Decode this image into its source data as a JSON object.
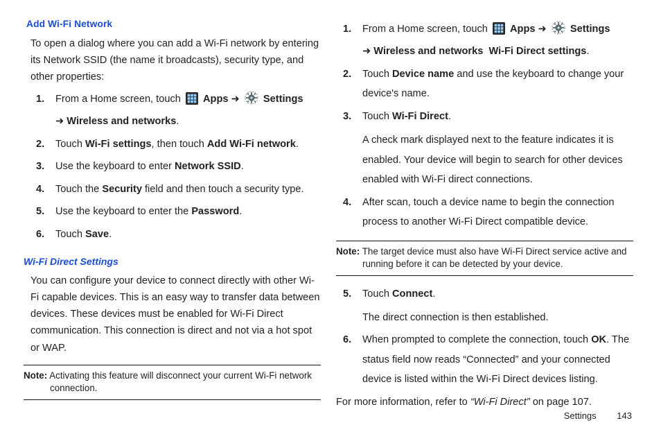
{
  "left": {
    "heading1": "Add Wi-Fi Network",
    "intro": "To open a dialog where you can add a Wi-Fi network by entering its Network SSID (the name it broadcasts), security type, and other properties:",
    "s1_prefix": "From a Home screen, touch ",
    "s1_apps": "Apps",
    "s1_settings": "Settings",
    "s1_line2_label": "Wireless and networks",
    "s2_a": "Touch ",
    "s2_b": "Wi-Fi settings",
    "s2_c": ", then touch ",
    "s2_d": "Add Wi-Fi network",
    "s3_a": "Use the keyboard to enter ",
    "s3_b": "Network SSID",
    "s4_a": "Touch the ",
    "s4_b": "Security",
    "s4_c": " field and then touch a security type.",
    "s5_a": "Use the keyboard to enter the ",
    "s5_b": "Password",
    "s6_a": "Touch ",
    "s6_b": "Save",
    "heading2": "Wi-Fi Direct Settings",
    "p2": "You can configure your device to connect directly with other Wi-Fi capable devices. This is an easy way to transfer data between devices. These devices must be enabled for Wi-Fi Direct communication. This connection is direct and not via a hot spot or WAP.",
    "note_label": "Note:",
    "note_a": " Activating this feature will disconnect your current Wi-Fi network",
    "note_b": "connection."
  },
  "right": {
    "r1_prefix": "From a Home screen, touch ",
    "r1_apps": "Apps",
    "r1_settings": "Settings",
    "r1_line2_a": "Wireless and networks",
    "r1_line2_b": "Wi-Fi Direct settings",
    "r2_a": "Touch ",
    "r2_b": "Device name",
    "r2_c": " and use the keyboard to change your device's name.",
    "r3_a": "Touch ",
    "r3_b": "Wi-Fi Direct",
    "r3_body": "A check mark displayed next to the feature indicates it is enabled. Your device will begin to search for other devices enabled with Wi-Fi direct connections.",
    "r4": "After scan, touch a device name to begin the connection process to another Wi-Fi Direct compatible device.",
    "note_label": "Note:",
    "note_a": " The target device must also have Wi-Fi Direct service active and",
    "note_b": "running before it can be detected by your device.",
    "r5_a": "Touch ",
    "r5_b": "Connect",
    "r5_body": "The direct connection is then established.",
    "r6_a": "When prompted to complete the connection, touch ",
    "r6_b": "OK",
    "r6_c": ". The status field now reads “Connected” and your connected device is listed within the Wi-Fi Direct devices listing.",
    "after_a": "For more information, refer to ",
    "after_b": "“Wi-Fi Direct”",
    "after_c": "  on page 107."
  },
  "nums": {
    "n1": "1.",
    "n2": "2.",
    "n3": "3.",
    "n4": "4.",
    "n5": "5.",
    "n6": "6."
  },
  "glyphs": {
    "arrow": "➜"
  },
  "footer": {
    "section": "Settings",
    "page": "143"
  }
}
